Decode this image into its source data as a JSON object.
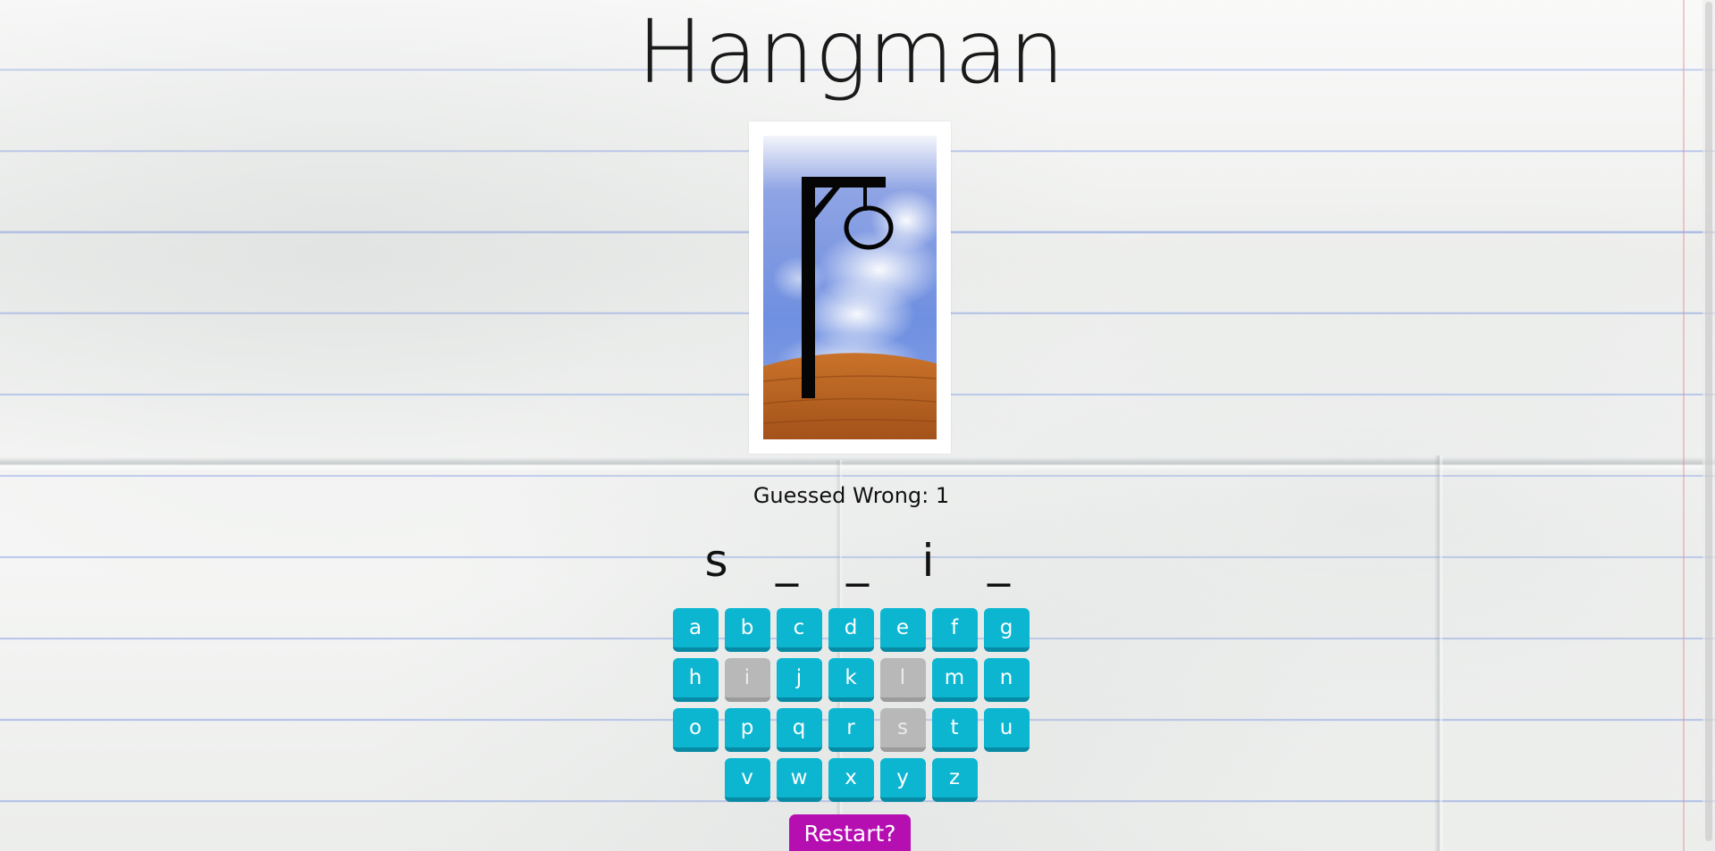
{
  "game": {
    "title": "Hangman",
    "wrong_label": "Guessed Wrong: 1",
    "word_slots": [
      "s",
      "_",
      "_",
      "i",
      "_"
    ],
    "restart_label": "Restart?"
  },
  "keyboard": {
    "rows": [
      [
        {
          "letter": "a",
          "used": false
        },
        {
          "letter": "b",
          "used": false
        },
        {
          "letter": "c",
          "used": false
        },
        {
          "letter": "d",
          "used": false
        },
        {
          "letter": "e",
          "used": false
        },
        {
          "letter": "f",
          "used": false
        },
        {
          "letter": "g",
          "used": false
        }
      ],
      [
        {
          "letter": "h",
          "used": false
        },
        {
          "letter": "i",
          "used": true
        },
        {
          "letter": "j",
          "used": false
        },
        {
          "letter": "k",
          "used": false
        },
        {
          "letter": "l",
          "used": true
        },
        {
          "letter": "m",
          "used": false
        },
        {
          "letter": "n",
          "used": false
        }
      ],
      [
        {
          "letter": "o",
          "used": false
        },
        {
          "letter": "p",
          "used": false
        },
        {
          "letter": "q",
          "used": false
        },
        {
          "letter": "r",
          "used": false
        },
        {
          "letter": "s",
          "used": true
        },
        {
          "letter": "t",
          "used": false
        },
        {
          "letter": "u",
          "used": false
        }
      ],
      [
        {
          "letter": "v",
          "used": false
        },
        {
          "letter": "w",
          "used": false
        },
        {
          "letter": "x",
          "used": false
        },
        {
          "letter": "y",
          "used": false
        },
        {
          "letter": "z",
          "used": false
        }
      ]
    ]
  },
  "colors": {
    "key": "#0cb6d1",
    "key_used": "#b8b8b8",
    "restart": "#b50fb2"
  }
}
